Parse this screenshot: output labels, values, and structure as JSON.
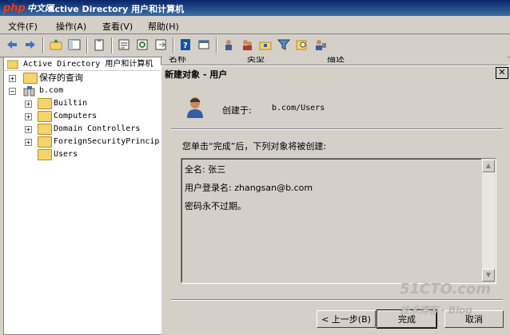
{
  "window": {
    "title": "Active Directory 用户和计算机",
    "logo": "php",
    "logo_cn": "中文网"
  },
  "menu": [
    {
      "label": "文件(F)"
    },
    {
      "label": "操作(A)"
    },
    {
      "label": "查看(V)"
    },
    {
      "label": "帮助(H)"
    }
  ],
  "tree": {
    "root": "Active Directory 用户和计算机",
    "saved": "保存的查询",
    "domain": "b.com",
    "children": [
      "Builtin",
      "Computers",
      "Domain Controllers",
      "ForeignSecurityPrincip",
      "Users"
    ]
  },
  "list_headers": [
    "名称",
    "类型",
    "描述"
  ],
  "dialog": {
    "title": "新建对象 - 用户",
    "created_in_label": "创建于:",
    "created_in_value": "b.com/Users",
    "prompt": "您单击“完成”后，下列对象将被创建:",
    "summary_lines": [
      "全名: 张三",
      "用户登录名: zhangsan@b.com",
      "密码永不过期。"
    ],
    "back_label": "< 上一步(B)",
    "finish_label": "完成",
    "cancel_label": "取消"
  },
  "watermark": {
    "line1": "51CTO.com",
    "line2": "技术博客 · Blog"
  }
}
